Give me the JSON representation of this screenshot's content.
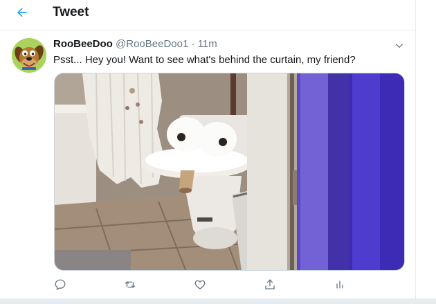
{
  "header": {
    "title": "Tweet"
  },
  "tweet": {
    "display_name": "RooBeeDoo",
    "handle": "@RooBeeDoo1",
    "separator": "·",
    "time": "11m",
    "text": "Psst... Hey you! Want to see what's behind the curtain, my friend?",
    "media_icon": "photo"
  },
  "icons": {
    "back": "arrow-left-icon",
    "more": "chevron-down-icon",
    "reply": "reply-icon",
    "retweet": "retweet-icon",
    "like": "heart-icon",
    "share": "share-icon",
    "analytics": "analytics-icon"
  },
  "colors": {
    "accent": "#1da1f2",
    "text": "#14171a",
    "secondary": "#657786",
    "border": "#e6ecf0"
  }
}
